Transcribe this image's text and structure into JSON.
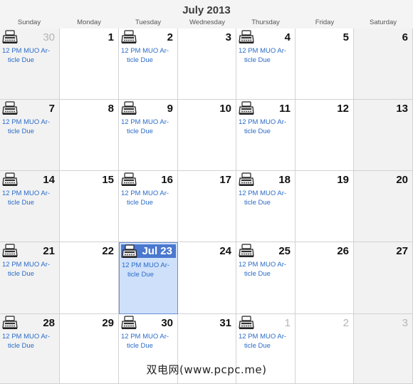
{
  "header": {
    "title": "July 2013"
  },
  "weekdays": [
    "Sunday",
    "Monday",
    "Tuesday",
    "Wednesday",
    "Thursday",
    "Friday",
    "Saturday"
  ],
  "event": {
    "line1": "12 PM MUO Ar-",
    "line2": "ticle Due"
  },
  "event_icon": "typewriter-icon",
  "colors": {
    "today_bg": "#cfe0fb",
    "today_label": "#4a78cf",
    "event_text": "#2b6cc7"
  },
  "weeks": [
    [
      {
        "label": "30",
        "other": true,
        "event": true
      },
      {
        "label": "1"
      },
      {
        "label": "2",
        "event": true
      },
      {
        "label": "3"
      },
      {
        "label": "4",
        "event": true
      },
      {
        "label": "5"
      },
      {
        "label": "6"
      }
    ],
    [
      {
        "label": "7",
        "event": true
      },
      {
        "label": "8"
      },
      {
        "label": "9",
        "event": true
      },
      {
        "label": "10"
      },
      {
        "label": "11",
        "event": true
      },
      {
        "label": "12"
      },
      {
        "label": "13"
      }
    ],
    [
      {
        "label": "14",
        "event": true
      },
      {
        "label": "15"
      },
      {
        "label": "16",
        "event": true
      },
      {
        "label": "17"
      },
      {
        "label": "18",
        "event": true
      },
      {
        "label": "19"
      },
      {
        "label": "20"
      }
    ],
    [
      {
        "label": "21",
        "event": true
      },
      {
        "label": "22"
      },
      {
        "label": "Jul 23",
        "today": true,
        "event": true
      },
      {
        "label": "24"
      },
      {
        "label": "25",
        "event": true
      },
      {
        "label": "26"
      },
      {
        "label": "27"
      }
    ],
    [
      {
        "label": "28",
        "event": true
      },
      {
        "label": "29"
      },
      {
        "label": "30",
        "event": true
      },
      {
        "label": "31"
      },
      {
        "label": "1",
        "other": true,
        "event": true
      },
      {
        "label": "2",
        "other": true
      },
      {
        "label": "3",
        "other": true
      }
    ]
  ],
  "watermark": "双电网(www.pcpc.me)"
}
